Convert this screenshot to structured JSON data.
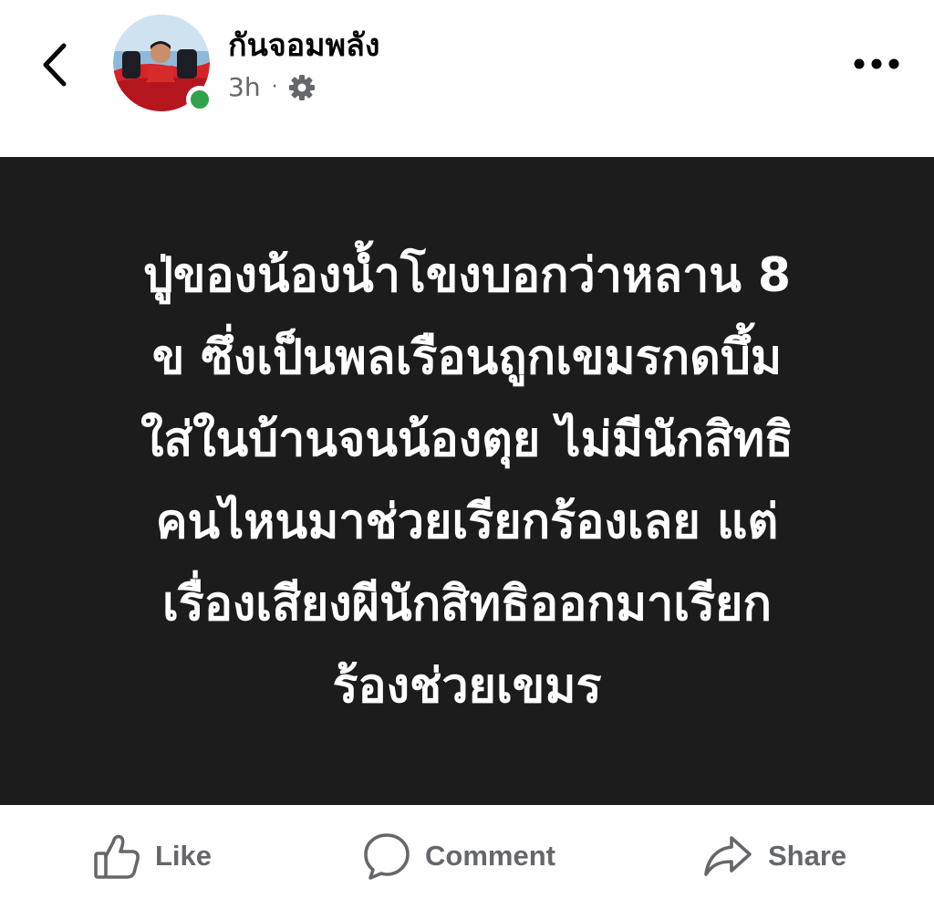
{
  "header": {
    "author_name": "กันจอมพลัง",
    "timestamp": "3h",
    "separator": "·",
    "privacy_icon": "gear-icon",
    "back_icon": "chevron-left-icon",
    "more_icon": "more-horizontal-icon",
    "online_status_color": "#31a24c"
  },
  "post": {
    "background_color": "#1c1c1c",
    "text_color": "#ffffff",
    "lines": [
      "ปู่ของน้องน้ำโขงบอกว่าหลาน 8",
      "ข ซึ่งเป็นพลเรือนถูกเขมรกดบึ้ม",
      "ใส่ในบ้านจนน้องตุย ไม่มีนักสิทธิ",
      "คนไหนมาช่วยเรียกร้องเลย แต่",
      "เรื่องเสียงผีนักสิทธิออกมาเรียก",
      "ร้องช่วยเขมร"
    ]
  },
  "actions": {
    "like_label": "Like",
    "comment_label": "Comment",
    "share_label": "Share",
    "icon_color": "#65676b"
  }
}
